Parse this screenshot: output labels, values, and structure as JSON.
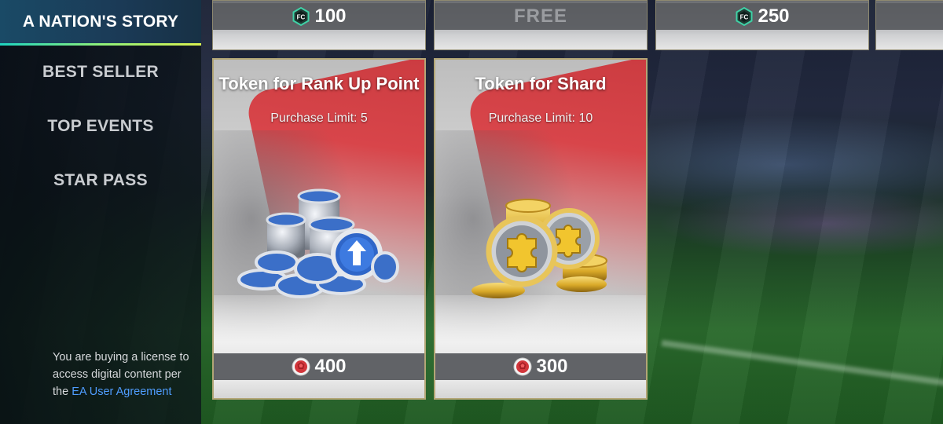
{
  "sidebar": {
    "active": "A NATION'S STORY",
    "items": [
      {
        "label": "BEST SELLER"
      },
      {
        "label": "TOP EVENTS"
      },
      {
        "label": "STAR PASS"
      }
    ],
    "legal_text": "You are buying a license to access digital content per the ",
    "legal_link": "EA User Agreement"
  },
  "top_row": [
    {
      "price": "100",
      "currency_icon": "fc-points-icon"
    },
    {
      "price": "FREE"
    },
    {
      "price": "250",
      "currency_icon": "fc-points-icon"
    }
  ],
  "offers": [
    {
      "title": "Token for Rank Up Point",
      "limit": "Purchase Limit: 5",
      "price": "400",
      "currency_icon": "red-gem-icon",
      "image_icon": "rank-up-tokens-icon"
    },
    {
      "title": "Token for Shard",
      "limit": "Purchase Limit: 10",
      "price": "300",
      "currency_icon": "red-gem-icon",
      "image_icon": "shard-puzzle-coins-icon"
    }
  ],
  "colors": {
    "accent_gradient": [
      "#1ed4c0",
      "#8ff07a",
      "#d8f050"
    ],
    "card_border": "#b3a676",
    "link": "#4f9dff"
  }
}
